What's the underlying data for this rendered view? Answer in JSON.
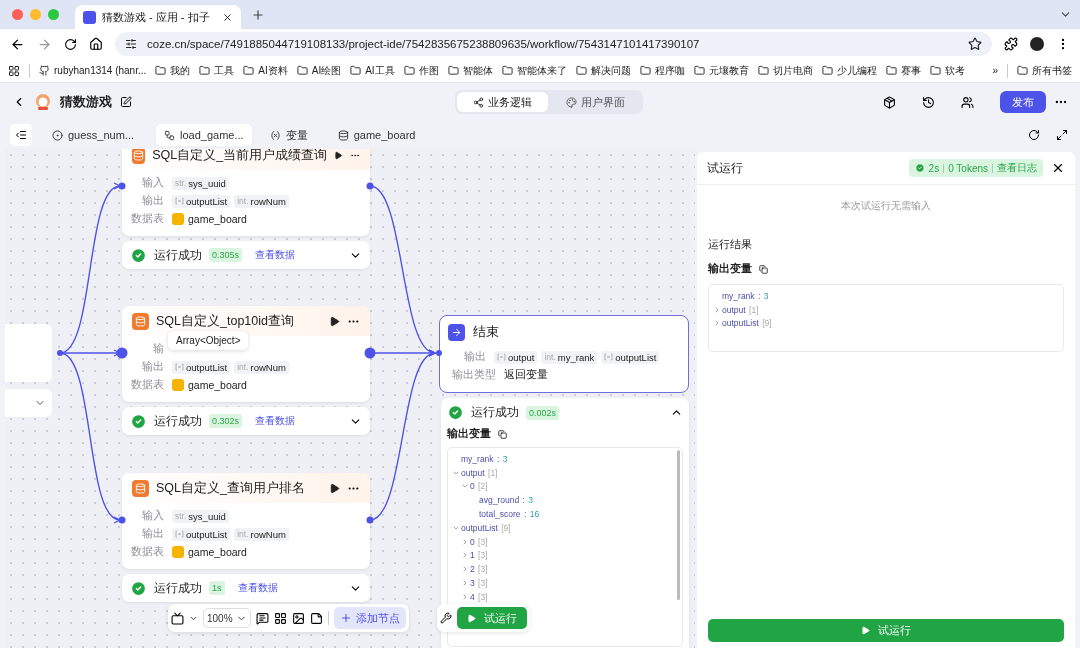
{
  "browser": {
    "tab_title": "猜数游戏 - 应用 - 扣子",
    "url": "coze.cn/space/7491885044719108133/project-ide/7542835675238809635/workflow/7543147101417390107",
    "bookmarks": [
      {
        "kind": "github",
        "label": "rubyhan1314 (hanr..."
      },
      {
        "kind": "folder",
        "label": "我的"
      },
      {
        "kind": "folder",
        "label": "工具"
      },
      {
        "kind": "folder",
        "label": "AI资料"
      },
      {
        "kind": "folder",
        "label": "AI绘图"
      },
      {
        "kind": "folder",
        "label": "AI工具"
      },
      {
        "kind": "folder",
        "label": "作图"
      },
      {
        "kind": "folder",
        "label": "智能体"
      },
      {
        "kind": "folder",
        "label": "智能体来了"
      },
      {
        "kind": "folder",
        "label": "解决问题"
      },
      {
        "kind": "folder",
        "label": "程序咖"
      },
      {
        "kind": "folder",
        "label": "元壤教育"
      },
      {
        "kind": "folder",
        "label": "切片电商"
      },
      {
        "kind": "folder",
        "label": "少儿编程"
      },
      {
        "kind": "folder",
        "label": "赛事"
      },
      {
        "kind": "folder",
        "label": "软考"
      }
    ],
    "overflow": "»",
    "all_bookmarks": "所有书签"
  },
  "header": {
    "title": "猜数游戏",
    "modes": [
      {
        "label": "业务逻辑",
        "kind": "logic",
        "selected": true
      },
      {
        "label": "用户界面",
        "kind": "ui",
        "selected": false
      }
    ],
    "publish": "发布"
  },
  "tabs": [
    {
      "label": "guess_num...",
      "kind": "workflow",
      "selected": false
    },
    {
      "label": "load_game...",
      "kind": "flow",
      "selected": true
    },
    {
      "label": "变量",
      "kind": "variable",
      "selected": false
    },
    {
      "label": "game_board",
      "kind": "table",
      "selected": false
    }
  ],
  "canvas": {
    "nodes": [
      {
        "title": "SQL自定义_当前用户成绩查询",
        "input_label": "输入",
        "inputs": [
          {
            "kind": "scalar",
            "type": "str.",
            "name": "sys_uuid"
          }
        ],
        "output_label": "输出",
        "outputs": [
          {
            "kind": "array",
            "name": "outputList"
          },
          {
            "kind": "scalar",
            "type": "int.",
            "name": "rowNum"
          }
        ],
        "table_label": "数据表",
        "table": "game_board",
        "result": {
          "status": "运行成功",
          "time": "0.305s",
          "link": "查看数据",
          "expanded": false
        }
      },
      {
        "title": "SQL自定义_top10id查询",
        "input_label": "输",
        "output_label": "输出",
        "outputs": [
          {
            "kind": "array",
            "name": "outputList"
          },
          {
            "kind": "scalar",
            "type": "int.",
            "name": "rowNum"
          }
        ],
        "table_label": "数据表",
        "table": "game_board",
        "result": {
          "status": "运行成功",
          "time": "0.302s",
          "link": "查看数据",
          "expanded": false
        }
      },
      {
        "title": "SQL自定义_查询用户排名",
        "input_label": "输入",
        "inputs": [
          {
            "kind": "scalar",
            "type": "str.",
            "name": "sys_uuid"
          }
        ],
        "output_label": "输出",
        "outputs": [
          {
            "kind": "array",
            "name": "outputList"
          },
          {
            "kind": "scalar",
            "type": "int.",
            "name": "rowNum"
          }
        ],
        "table_label": "数据表",
        "table": "game_board",
        "result": {
          "status": "运行成功",
          "time": "1s",
          "link": "查看数据",
          "expanded": false
        }
      }
    ],
    "tooltip": "Array<Object>",
    "end_node": {
      "title": "结束",
      "output_label": "输出",
      "outputs": [
        {
          "kind": "array",
          "name": "output"
        },
        {
          "kind": "scalar",
          "type": "int.",
          "name": "my_rank"
        },
        {
          "kind": "array",
          "name": "outputList"
        }
      ],
      "type_label": "输出类型",
      "type_value": "返回变量",
      "result": {
        "status": "运行成功",
        "time": "0.002s",
        "expanded": true,
        "vars_label": "输出变量",
        "tree": [
          {
            "key": "my_rank",
            "sep": ":",
            "value": "3"
          },
          {
            "key": "output",
            "count": "[1]",
            "expanded": true,
            "children": [
              {
                "key": "0",
                "count": "[2]",
                "expanded": true,
                "children": [
                  {
                    "key": "avg_round",
                    "sep": ":",
                    "value": "3"
                  },
                  {
                    "key": "total_score",
                    "sep": ":",
                    "value": "16"
                  }
                ]
              }
            ]
          },
          {
            "key": "outputList",
            "count": "[9]",
            "expanded": true,
            "children": [
              {
                "key": "0",
                "count": "[3]",
                "expanded": false
              },
              {
                "key": "1",
                "count": "[3]",
                "expanded": false
              },
              {
                "key": "2",
                "count": "[3]",
                "expanded": false
              },
              {
                "key": "3",
                "count": "[3]",
                "expanded": false
              },
              {
                "key": "4",
                "count": "[3]",
                "expanded": false
              }
            ]
          }
        ]
      }
    },
    "toolbar": {
      "zoom": "100%",
      "add_node": "添加节点",
      "test_run": "试运行"
    }
  },
  "panel": {
    "title": "试运行",
    "badge": {
      "time": "2s",
      "tokens": "0 Tokens",
      "log": "查看日志"
    },
    "no_input": "本次试运行无需输入",
    "results_label": "运行结果",
    "vars_label": "输出变量",
    "tree": [
      {
        "key": "my_rank",
        "sep": ":",
        "value": "3"
      },
      {
        "key": "output",
        "count": "[1]",
        "expanded": false
      },
      {
        "key": "outputList",
        "count": "[9]",
        "expanded": false
      }
    ],
    "run": "试运行"
  }
}
